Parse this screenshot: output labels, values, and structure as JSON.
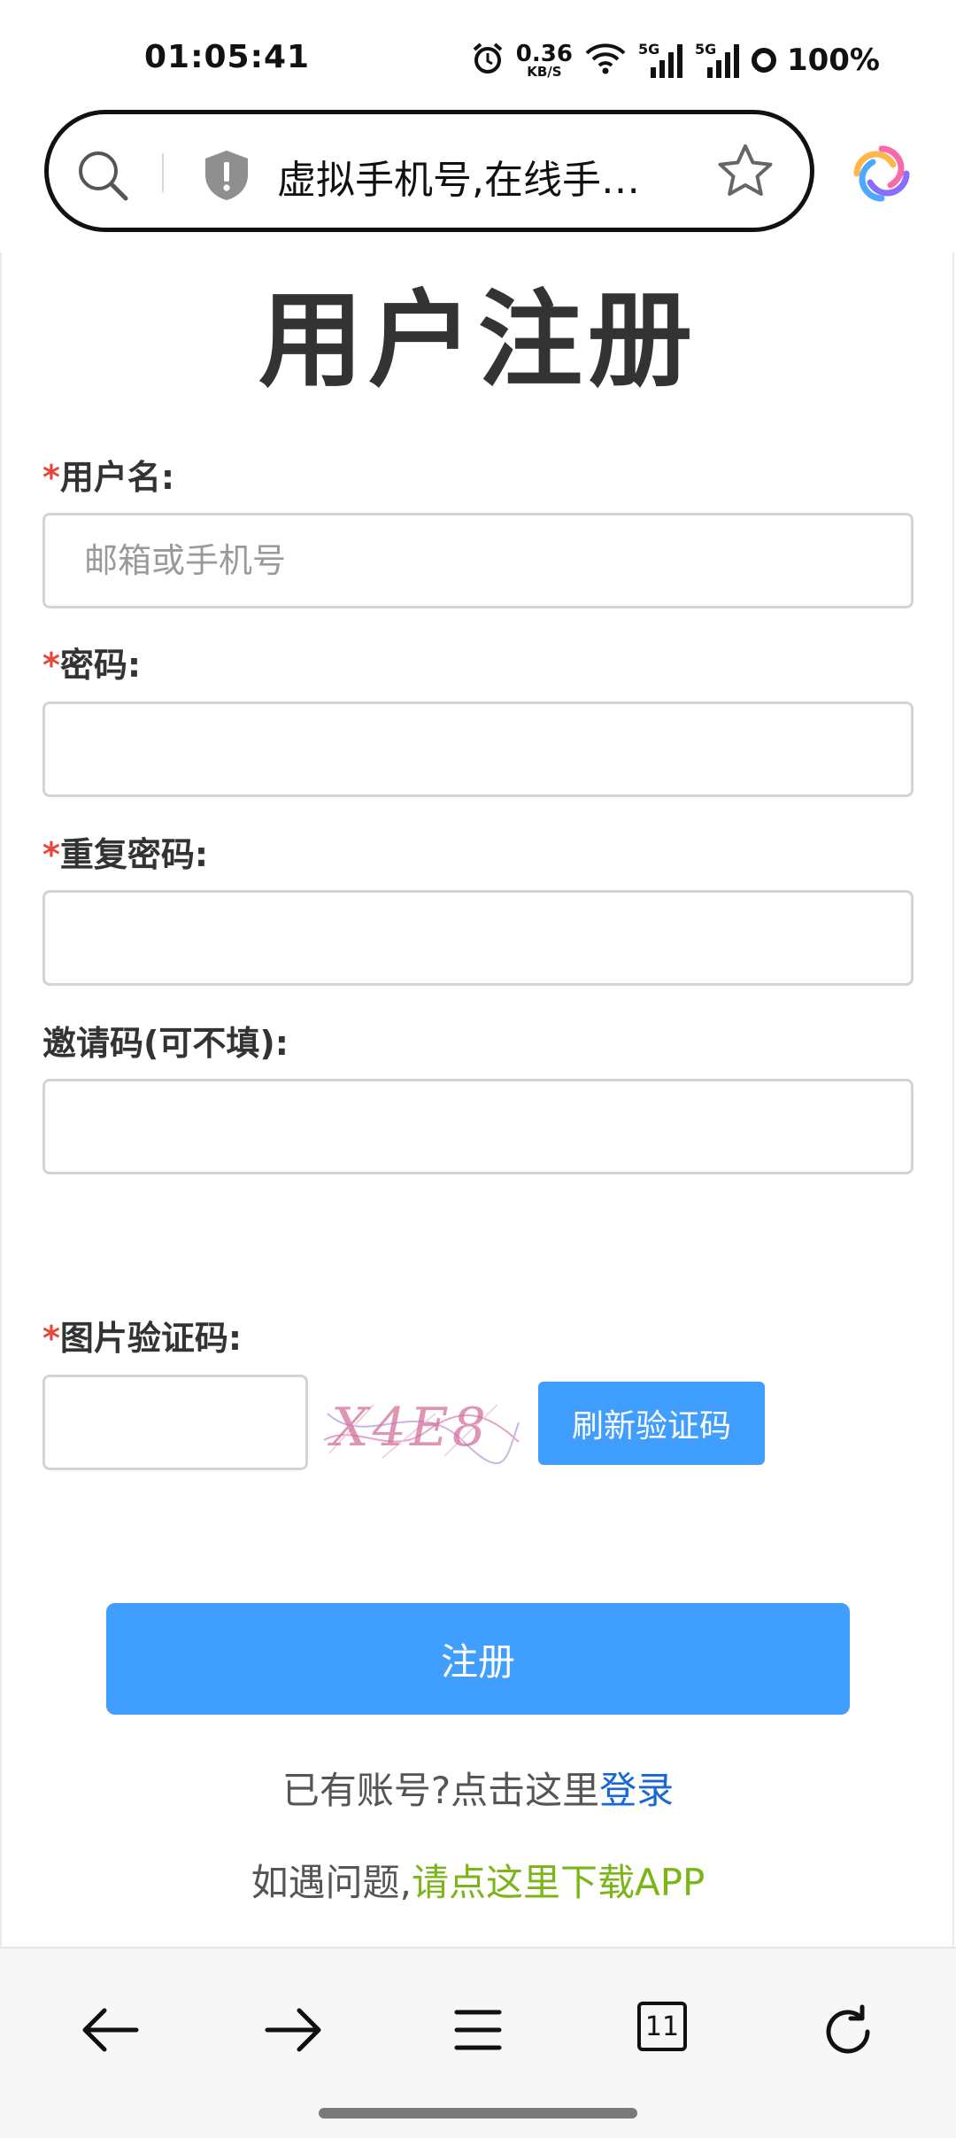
{
  "status_bar": {
    "time": "01:05:41",
    "net_speed_value": "0.36",
    "net_speed_unit": "KB/S",
    "signal1_label": "5G",
    "signal2_label": "5G",
    "battery": "100%"
  },
  "browser": {
    "url_title": "虚拟手机号,在线手…",
    "open_tabs": "11"
  },
  "form": {
    "title": "用户注册",
    "required_mark": "*",
    "username_label": "用户名:",
    "username_placeholder": "邮箱或手机号",
    "password_label": "密码:",
    "confirm_password_label": "重复密码:",
    "invite_label": "邀请码(可不填):",
    "captcha_label": "图片验证码:",
    "captcha_text": "X4E8",
    "refresh_captcha_label": "刷新验证码",
    "submit_label": "注册"
  },
  "footer_links": {
    "login_prompt": "已有账号?点击这里",
    "login_link": "登录",
    "help_prompt": "如遇问题,",
    "download_link": "请点这里下载APP"
  },
  "colors": {
    "primary": "#409eff",
    "required": "#e8453c",
    "login_link": "#1967d2",
    "download_link": "#7cb518"
  },
  "icons": {
    "url_search": "search-icon",
    "url_security": "shield-icon",
    "bookmark": "star-icon",
    "back": "arrow-left-icon",
    "forward": "arrow-right-icon",
    "menu": "menu-icon",
    "tabs": "tabs-icon",
    "refresh": "refresh-icon"
  }
}
